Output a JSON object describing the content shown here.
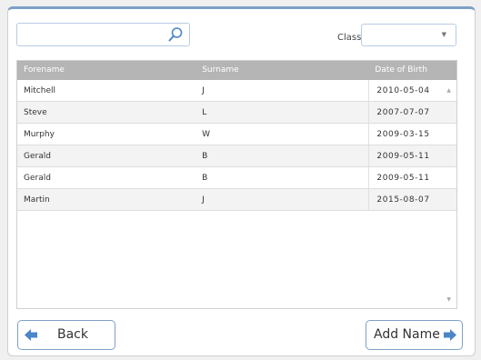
{
  "search": {
    "placeholder": ""
  },
  "class_filter": {
    "label": "Class",
    "value": ""
  },
  "table": {
    "columns": [
      "Forename",
      "Surname",
      "Date of Birth"
    ],
    "rows": [
      [
        "Mitchell",
        "J",
        "2010-05-04"
      ],
      [
        "Steve",
        "L",
        "2007-07-07"
      ],
      [
        "Murphy",
        "W",
        "2009-03-15"
      ],
      [
        "Gerald",
        "B",
        "2009-05-11"
      ],
      [
        "Gerald",
        "B",
        "2009-05-11"
      ],
      [
        "Martin",
        "J",
        "2015-08-07"
      ]
    ]
  },
  "buttons": {
    "back": "Back",
    "add_name": "Add Name"
  },
  "icons": {
    "search": "search-icon",
    "back_arrow": "arrow-left-icon",
    "add_arrow": "arrow-right-icon",
    "dropdown": "chevron-down-icon"
  },
  "colors": {
    "accent": "#7da0c8",
    "arrow": "#4a86c8",
    "header": "#b5b5b5"
  }
}
